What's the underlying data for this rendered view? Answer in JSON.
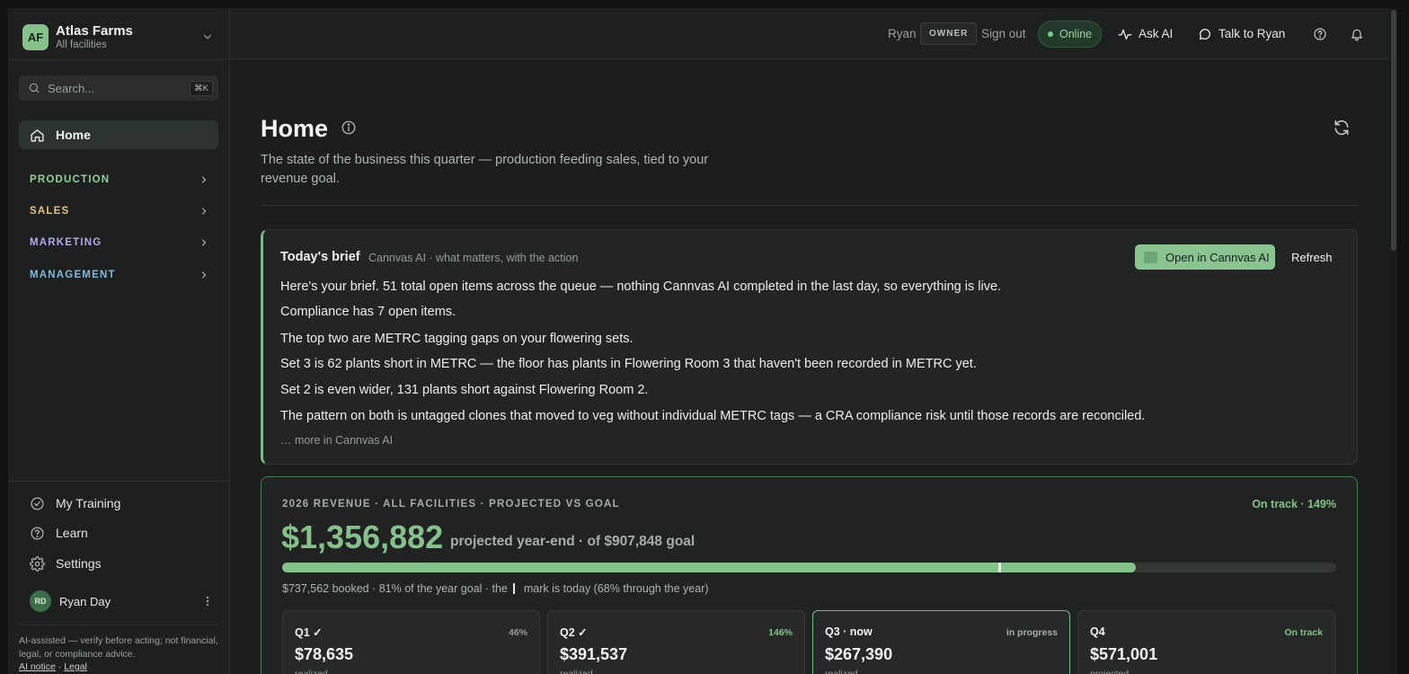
{
  "org": {
    "initials": "AF",
    "name": "Atlas Farms",
    "subtitle": "All facilities"
  },
  "search": {
    "placeholder": "Search...",
    "shortcut": "⌘K"
  },
  "nav": {
    "home": "Home",
    "sections": [
      {
        "label": "PRODUCTION",
        "color": "#8fd09a"
      },
      {
        "label": "SALES",
        "color": "#e2c27a"
      },
      {
        "label": "MARKETING",
        "color": "#b7a6e6"
      },
      {
        "label": "MANAGEMENT",
        "color": "#7fb8d8"
      }
    ],
    "bottom": [
      {
        "label": "My Training",
        "icon": "check-circle-icon"
      },
      {
        "label": "Learn",
        "icon": "help-circle-icon"
      },
      {
        "label": "Settings",
        "icon": "gear-icon"
      }
    ]
  },
  "user": {
    "initials": "RD",
    "name": "Ryan Day"
  },
  "disclaimer": "AI-assisted — verify before acting; not financial, legal, or compliance advice.",
  "legal": {
    "ai_notice": "AI notice",
    "separator": "·",
    "legal": "Legal"
  },
  "topbar": {
    "user": "Ryan",
    "role": "OWNER",
    "sign_out": "Sign out",
    "status": "Online",
    "ask_ai": "Ask AI",
    "talk_to": "Talk to Ryan"
  },
  "page": {
    "title": "Home",
    "description": "The state of the business this quarter — production feeding sales, tied to your revenue goal."
  },
  "brief": {
    "title": "Today's brief",
    "subtitle": "Cannvas AI · what matters, with the action",
    "open_button": "Open in Cannvas AI",
    "refresh_button": "Refresh",
    "lines": [
      "Here's your brief. 51 total open items across the queue — nothing Cannvas AI completed in the last day, so everything is live.",
      "Compliance has 7 open items.",
      "The top two are METRC tagging gaps on your flowering sets.",
      "Set 3 is 62 plants short in METRC — the floor has plants in Flowering Room 3 that haven't been recorded in METRC yet.",
      "Set 2 is even wider, 131 plants short against Flowering Room 2.",
      "The pattern on both is untagged clones that moved to veg without individual METRC tags — a CRA compliance risk until those records are reconciled."
    ],
    "more": "… more in Cannvas AI"
  },
  "revenue": {
    "label": "2026 REVENUE · ALL FACILITIES · PROJECTED VS GOAL",
    "status": "On track · 149%",
    "amount": "$1,356,882",
    "caption": "projected year-end · of $907,848 goal",
    "progress_fraction": 0.81,
    "today_fraction": 0.68,
    "note_before": "$737,562 booked · 81% of the year goal · the",
    "note_after": "mark is today (68% through the year)",
    "quarters": [
      {
        "label": "Q1 ✓",
        "pct": "46%",
        "amount": "$78,635",
        "sub": "realized",
        "pct_color": "#959b97"
      },
      {
        "label": "Q2 ✓",
        "pct": "146%",
        "amount": "$391,537",
        "sub": "realized",
        "pct_color": "#86c08a"
      },
      {
        "label": "Q3 · now",
        "pct": "in progress",
        "amount": "$267,390",
        "sub": "realized",
        "pct_color": "#a7ada9"
      },
      {
        "label": "Q4",
        "pct": "On track",
        "amount": "$571,001",
        "sub": "projected",
        "pct_color": "#86c08a"
      }
    ]
  }
}
